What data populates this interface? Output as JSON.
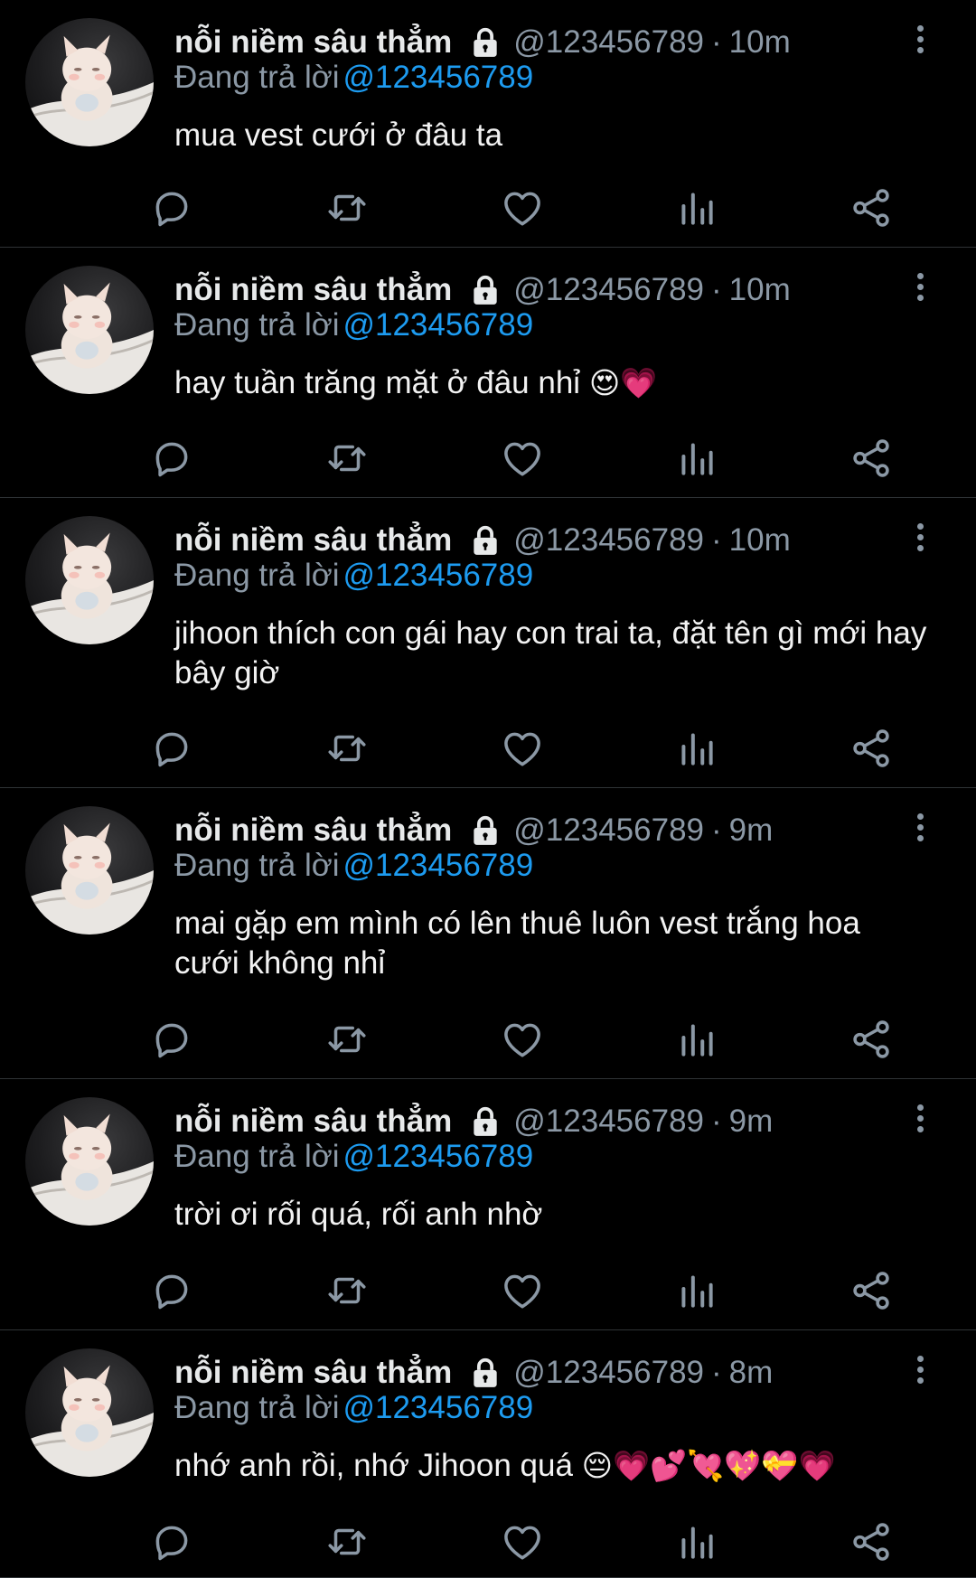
{
  "colors": {
    "background": "#000000",
    "text": "#e7e9ea",
    "muted": "#8b98a5",
    "link": "#1d9bf0",
    "divider": "#2f3336"
  },
  "author": {
    "name": "nỗi niềm sâu thẳm",
    "handle": "@123456789",
    "protected_icon": "lock-icon",
    "avatar": "plush-toy-avatar"
  },
  "reply_prefix": "Đang trả lời",
  "reply_to": "@123456789",
  "separator": "·",
  "action_icons": [
    "reply-icon",
    "retweet-icon",
    "like-icon",
    "views-icon",
    "share-icon"
  ],
  "tweets": [
    {
      "time": "10m",
      "text": "mua vest cưới ở đâu ta",
      "emoji": ""
    },
    {
      "time": "10m",
      "text": "hay tuần trăng mặt ở đâu nhỉ",
      "emoji": "😍💗"
    },
    {
      "time": "10m",
      "text": "jihoon thích con gái hay con trai ta, đặt tên gì mới hay bây giờ",
      "emoji": ""
    },
    {
      "time": "9m",
      "text": "mai gặp em mình có lên thuê luôn vest trắng hoa cưới không nhỉ",
      "emoji": ""
    },
    {
      "time": "9m",
      "text": "trời ơi rối quá, rối anh nhờ",
      "emoji": ""
    },
    {
      "time": "8m",
      "text": "nhớ anh rồi, nhớ Jihoon quá",
      "emoji": "😔💗💕💘💖💝💗"
    }
  ]
}
